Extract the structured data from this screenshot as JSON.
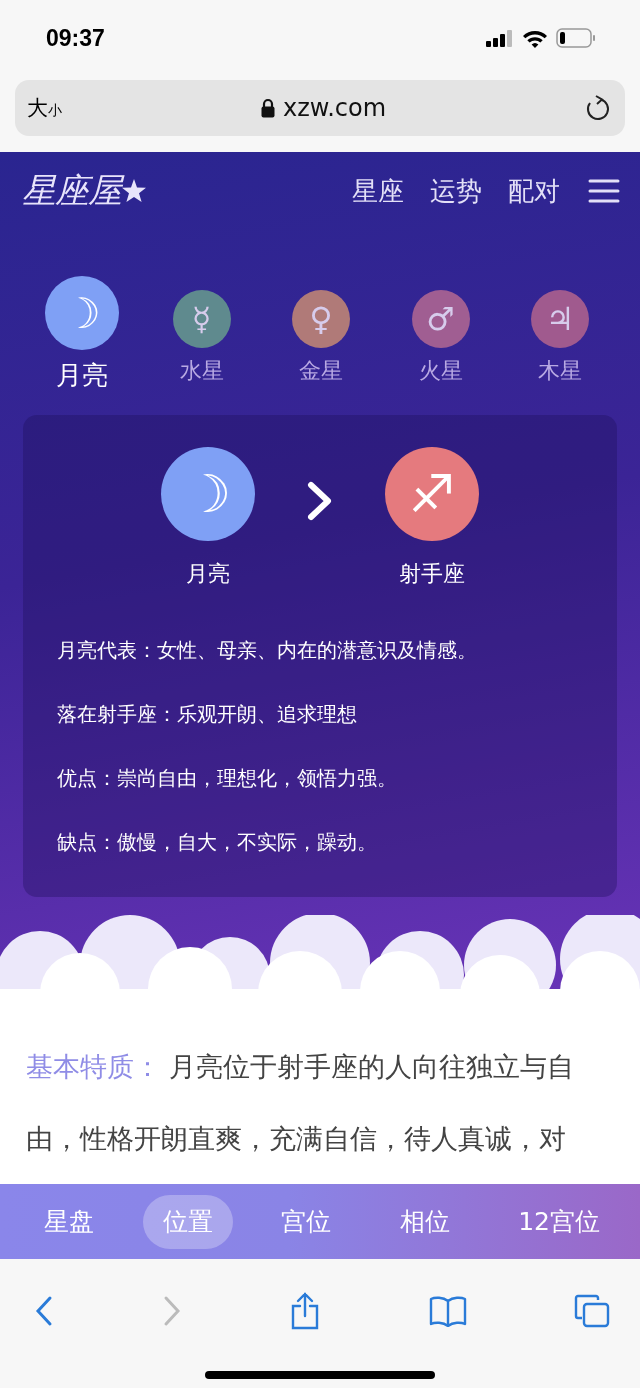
{
  "status_bar": {
    "time": "09:37"
  },
  "browser": {
    "text_size": {
      "large": "大",
      "small": "小"
    },
    "url": "xzw.com"
  },
  "site_header": {
    "logo": "星座屋",
    "nav": [
      "星座",
      "运势",
      "配对"
    ]
  },
  "planets": [
    {
      "symbol": "☽",
      "label": "月亮",
      "color": "#7fa0f5",
      "selected": true
    },
    {
      "symbol": "☿",
      "label": "水星",
      "color": "#5f8a8e",
      "selected": false
    },
    {
      "symbol": "♀",
      "label": "金星",
      "color": "#b07a78",
      "selected": false
    },
    {
      "symbol": "♂",
      "label": "火星",
      "color": "#a05e92",
      "selected": false
    },
    {
      "symbol": "♃",
      "label": "木星",
      "color": "#a05a8e",
      "selected": false
    }
  ],
  "placement": {
    "planet": {
      "symbol": "☽",
      "label": "月亮",
      "color": "#7fa0f5"
    },
    "sign": {
      "symbol": "♐",
      "label": "射手座",
      "color": "#e57a7e"
    },
    "lines": [
      "月亮代表：女性、母亲、内在的潜意识及情感。",
      "落在射手座：乐观开朗、追求理想",
      "优点：崇尚自由，理想化，领悟力强。",
      "缺点：傲慢，自大，不实际，躁动。"
    ]
  },
  "article": {
    "label": "基本特质：",
    "lines": [
      "月亮位于射手座的人向往独立与自",
      "由，性格开朗直爽，充满自信，待人真诚，对"
    ]
  },
  "bottom_tabs": [
    {
      "label": "星盘",
      "selected": false
    },
    {
      "label": "位置",
      "selected": true
    },
    {
      "label": "宫位",
      "selected": false
    },
    {
      "label": "相位",
      "selected": false
    },
    {
      "label": "12宫位",
      "selected": false
    }
  ],
  "toolbar": {
    "back_enabled": true,
    "forward_enabled": false
  }
}
